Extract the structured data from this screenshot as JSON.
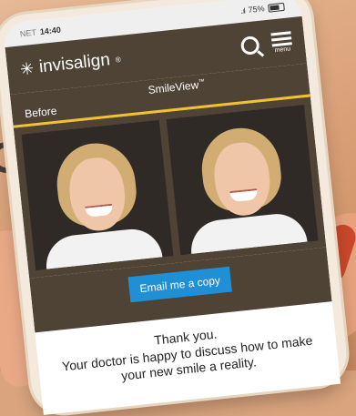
{
  "status_bar": {
    "carrier": "NET",
    "time": "14:40",
    "signal": "..ıl",
    "battery": "75%"
  },
  "header": {
    "brand": "invisalign",
    "trademark": "®",
    "menu_label": "menu",
    "icons": [
      "invisalign-logo-icon",
      "search-icon",
      "menu-icon"
    ]
  },
  "compare": {
    "before_label": "Before",
    "title": "SmileView",
    "trademark": "™"
  },
  "action": {
    "email_label": "Email me a copy"
  },
  "message": {
    "title": "Thank you.",
    "body": "Your doctor is happy to discuss how to make your new smile a reality."
  },
  "colors": {
    "header": "#4f4336",
    "accent": "#f1c232",
    "button": "#1f8fd6"
  }
}
